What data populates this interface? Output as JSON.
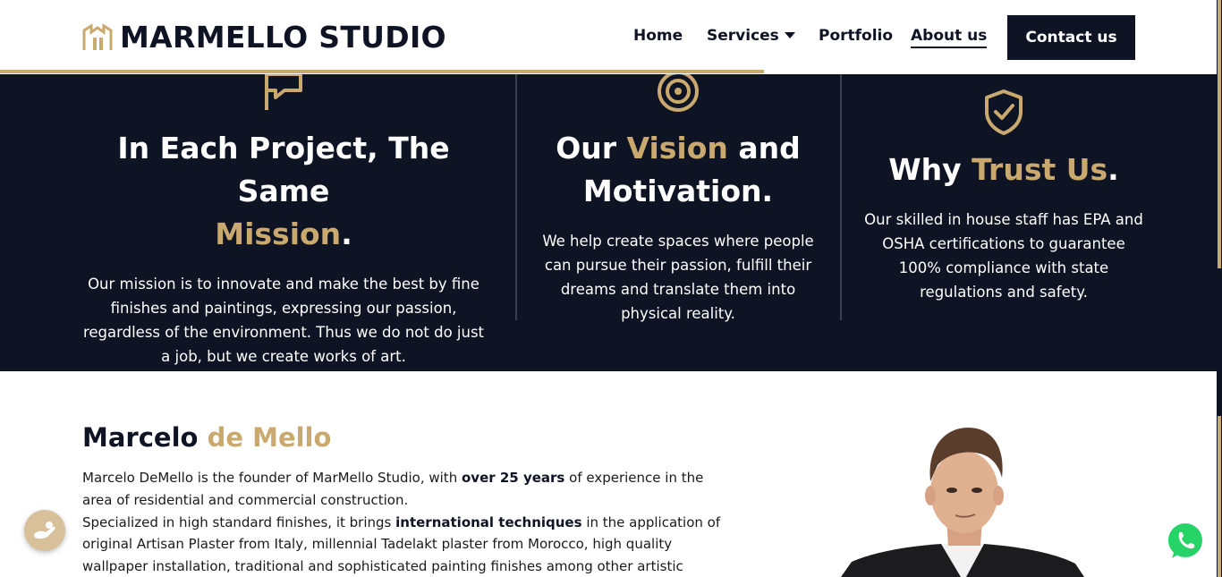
{
  "header": {
    "brand": "MARMELLO STUDIO",
    "nav": [
      {
        "label": "Home"
      },
      {
        "label": "Services"
      },
      {
        "label": "Portfolio"
      },
      {
        "label": "About us"
      }
    ],
    "cta_label": "Contact us"
  },
  "pillars": [
    {
      "title_pre": "In Each Project, The Same",
      "title_accent": "Mission",
      "title_post": ".",
      "text": "Our mission is to innovate and make the best by fine finishes and paintings, expressing our passion, regardless of the environment. Thus we do not do just a job, but we create works of art.",
      "icon": "flag-icon"
    },
    {
      "title_pre": "Our",
      "title_accent": "Vision",
      "title_post": "and Motivation.",
      "text": "We help create spaces where people can pursue their passion, fulfill their dreams and translate them into physical reality.",
      "icon": "target-icon"
    },
    {
      "title_pre": "Why",
      "title_accent": "Trust Us",
      "title_post": ".",
      "text": "Our skilled in house staff has EPA and OSHA certifications to guarantee 100% compliance with state regulations and safety.",
      "icon": "shield-check-icon"
    }
  ],
  "bio": {
    "name_first": "Marcelo",
    "name_accent": "de Mello",
    "p1_a": "Marcelo DeMello is the founder of MarMello Studio, with",
    "p1_bold": "over 25 years",
    "p1_b": "of experience in the area of residential and commercial construction.",
    "p2_a": "Specialized in high standard finishes, it brings",
    "p2_bold": "international techniques",
    "p2_b": "in the application of original Artisan Plaster from Italy, millennial Tadelakt plaster from Morocco, high quality wallpaper installation, traditional and sophisticated painting finishes among other artistic finishes."
  },
  "colors": {
    "navy": "#0f1424",
    "gold": "#c9a96e",
    "whatsapp": "#25d366"
  }
}
